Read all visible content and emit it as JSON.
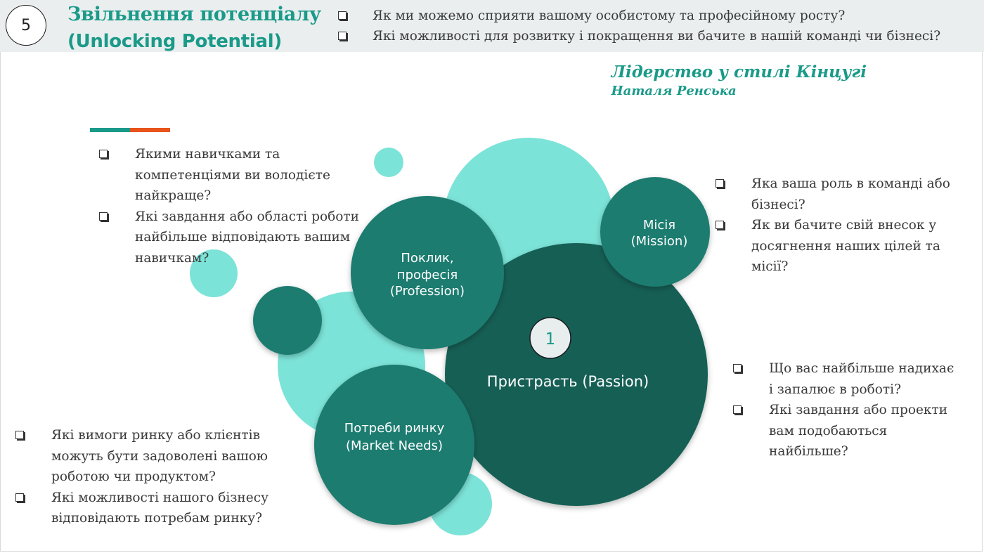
{
  "header": {
    "step_number": "5",
    "title_line1": "Звільнення потенціалу",
    "title_line2": "(Unlocking Potential)",
    "questions": [
      "Як ми можемо сприяти вашому особистому та професійному росту?",
      "Які можливості для розвитку і покращення ви бачите в нашій команді чи бізнесі?"
    ]
  },
  "signature": {
    "book": "Лідерство у стилі Кінцугі",
    "author": "Наталя Ренська"
  },
  "colors": {
    "accent_teal": "#1a9a89",
    "accent_orange": "#e8541c",
    "circle_dark": "#145e54",
    "circle_mid": "#1c7b70",
    "circle_light": "#7ce3d8"
  },
  "diagram": {
    "passion": {
      "badge": "1",
      "label": "Пристрасть (Passion)"
    },
    "profession": {
      "label_lines": [
        "Поклик,",
        "професія",
        "(Profession)"
      ]
    },
    "mission": {
      "label_lines": [
        "Місія",
        "(Mission)"
      ]
    },
    "market": {
      "label_lines": [
        "Потреби ринку",
        "(Market Needs)"
      ]
    }
  },
  "questions": {
    "profession": [
      "Якими навичками та компетенціями ви володієте найкраще?",
      "Які завдання або області роботи найбільше відповідають вашим навичкам?"
    ],
    "mission": [
      "Яка ваша роль в команді або бізнесі?",
      "Як ви бачите свій внесок у досягнення наших цілей та місії?"
    ],
    "passion": [
      "Що вас найбільше надихає і запалює в роботі?",
      "Які завдання або проекти вам подобаються найбільше?"
    ],
    "market": [
      "Які вимоги ринку або клієнтів можуть бути задоволені вашою роботою чи продуктом?",
      "Які можливості нашого бізнесу відповідають потребам ринку?"
    ]
  }
}
